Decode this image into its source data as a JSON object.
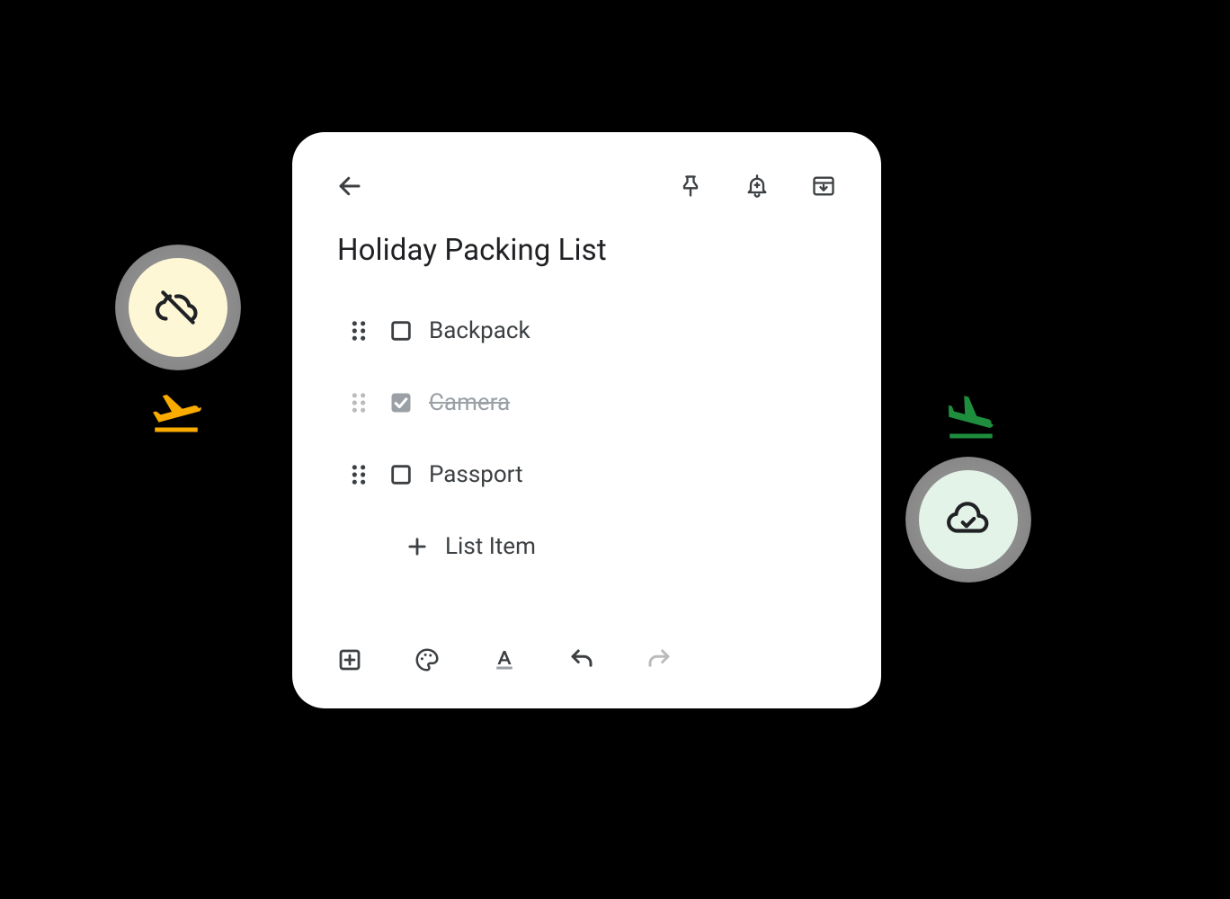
{
  "note": {
    "title": "Holiday Packing List",
    "items": [
      {
        "label": "Backpack",
        "checked": false
      },
      {
        "label": "Camera",
        "checked": true
      },
      {
        "label": "Passport",
        "checked": false
      }
    ],
    "addPlaceholder": "List Item"
  },
  "topbar": {
    "back": "arrow-back",
    "actions": [
      "pin",
      "reminder",
      "archive"
    ]
  },
  "bottombar": {
    "actions": [
      "add-box",
      "palette",
      "text-format",
      "undo",
      "redo"
    ]
  },
  "decor": {
    "before": {
      "icon": "cloud-off",
      "travel": "flight-takeoff",
      "color": "#F9AB00",
      "bg": "#FEF7D6"
    },
    "after": {
      "icon": "cloud-done",
      "travel": "flight-land",
      "color": "#1E8E3E",
      "bg": "#E3F3E8"
    }
  }
}
